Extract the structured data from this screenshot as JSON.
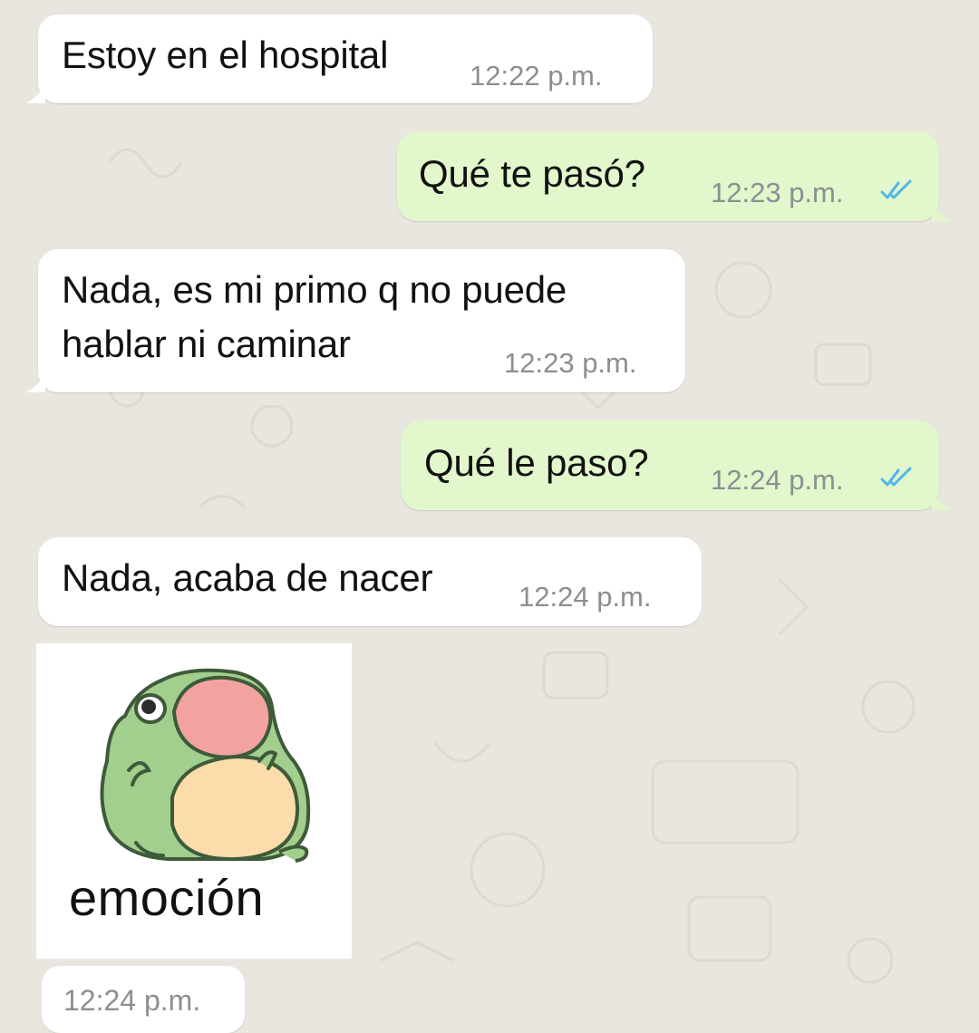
{
  "colors": {
    "incoming_bubble": "#ffffff",
    "outgoing_bubble": "#e2f7cb",
    "read_check": "#4fb6ec",
    "background": "#e8e6df",
    "timestamp": "#8a8f93"
  },
  "messages": [
    {
      "direction": "incoming",
      "text": "Estoy en el hospital",
      "time": "12:22 p.m."
    },
    {
      "direction": "outgoing",
      "text": "Qué te pasó?",
      "time": "12:23 p.m.",
      "status": "read"
    },
    {
      "direction": "incoming",
      "lines": [
        "Nada, es mi primo q no puede",
        "hablar ni caminar"
      ],
      "time": "12:23 p.m."
    },
    {
      "direction": "outgoing",
      "text": "Qué le paso?",
      "time": "12:24 p.m.",
      "status": "read"
    },
    {
      "direction": "incoming",
      "text": "Nada, acaba de nacer",
      "time": "12:24 p.m."
    }
  ],
  "sticker": {
    "direction": "incoming",
    "image": "frog-sticker",
    "caption": "emoción",
    "time": "12:24 p.m."
  }
}
